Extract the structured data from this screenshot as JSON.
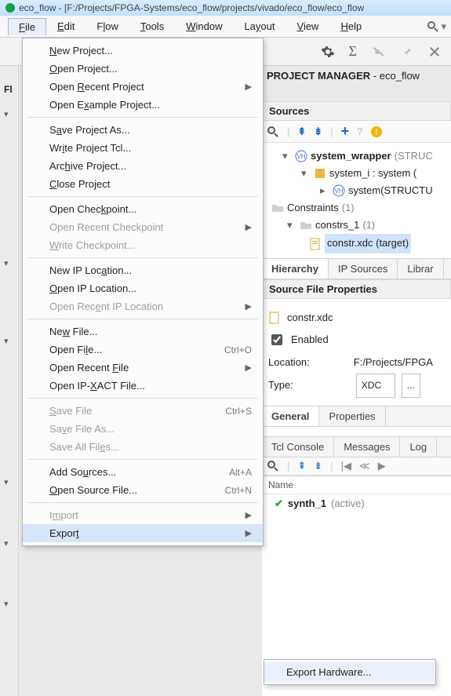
{
  "titlebar": "eco_flow - [F:/Projects/FPGA-Systems/eco_flow/projects/vivado/eco_flow/eco_flow",
  "menubar": {
    "file": "File",
    "edit": "Edit",
    "flow": "Flow",
    "tools": "Tools",
    "window": "Window",
    "layout": "Layout",
    "view": "View",
    "help": "Help"
  },
  "pm": {
    "title": "PROJECT MANAGER",
    "project": "eco_flow"
  },
  "leftStrip": {
    "header": "Fl"
  },
  "sources": {
    "header": "Sources",
    "nodes": {
      "system_wrapper": "system_wrapper",
      "system_wrapper_suffix": "(STRUC",
      "system_i": "system_i : system (",
      "system": "system(STRUCTU",
      "constraints": "Constraints",
      "constraints_count": "(1)",
      "constrs_1": "constrs_1",
      "constrs_1_count": "(1)",
      "constr_file": "constr.xdc (target)"
    },
    "tabs": {
      "hierarchy": "Hierarchy",
      "ip": "IP Sources",
      "lib": "Librar"
    }
  },
  "props": {
    "header": "Source File Properties",
    "file": "constr.xdc",
    "enabled_lbl": "Enabled",
    "location_lbl": "Location:",
    "location_val": "F:/Projects/FPGA",
    "type_lbl": "Type:",
    "type_val": "XDC",
    "tabs": {
      "general": "General",
      "properties": "Properties"
    }
  },
  "bottomtabs": {
    "tcl": "Tcl Console",
    "messages": "Messages",
    "log": "Log"
  },
  "runs": {
    "col_name": "Name",
    "synth": "synth_1",
    "active": "(active)"
  },
  "menu": {
    "newProject": "New Project...",
    "openProject": "Open Project...",
    "openRecent": "Open Recent Project",
    "openExample": "Open Example Project...",
    "saveAs": "Save Project As...",
    "writeTcl": "Write Project Tcl...",
    "archive": "Archive Project...",
    "close": "Close Project",
    "openCkpt": "Open Checkpoint...",
    "openRecentCkpt": "Open Recent Checkpoint",
    "writeCkpt": "Write Checkpoint...",
    "newIpLoc": "New IP Location...",
    "openIpLoc": "Open IP Location...",
    "openRecentIpLoc": "Open Recent IP Location",
    "newFile": "New File...",
    "openFile": "Open File...",
    "openFile_sc": "Ctrl+O",
    "openRecentFile": "Open Recent File",
    "openIpxact": "Open IP-XACT File...",
    "saveFile": "Save File",
    "saveFile_sc": "Ctrl+S",
    "saveFileAs": "Save File As...",
    "saveAll": "Save All Files...",
    "addSources": "Add Sources...",
    "addSources_sc": "Alt+A",
    "openSource": "Open Source File...",
    "openSource_sc": "Ctrl+N",
    "import": "Import",
    "export": "Export",
    "exportHw": "Export Hardware..."
  }
}
